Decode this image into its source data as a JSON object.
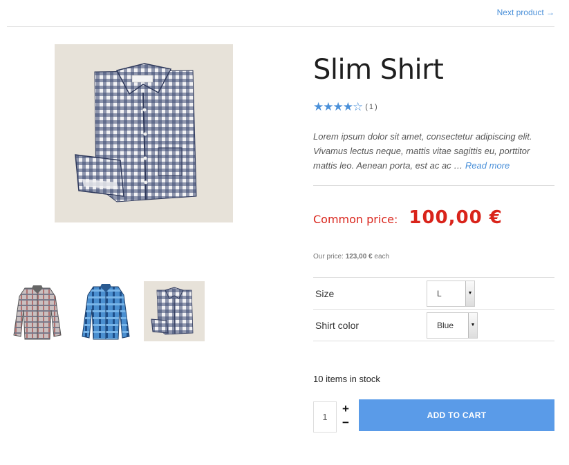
{
  "nav": {
    "next_label": "Next product →"
  },
  "product": {
    "title": "Slim Shirt",
    "rating": {
      "stars": 4.5,
      "stars_display": "★★★★☆",
      "count": "(1)"
    },
    "description": "Lorem ipsum dolor sit amet, consectetur adipiscing elit. Vivamus lectus neque, mattis vitae sagittis eu, porttitor mattis leo. Aenean porta, est ac ac …",
    "read_more": "Read more",
    "common_price_label": "Common price:",
    "common_price_value": "100,00 €",
    "our_price_label": "Our price:",
    "our_price_value": "123,00 €",
    "our_price_unit": "each"
  },
  "images": {
    "main": "checked-shirt-folded",
    "thumbs": [
      {
        "name": "grey-plaid-shirt-thumb"
      },
      {
        "name": "blue-plaid-shirt-thumb"
      },
      {
        "name": "navy-gingham-folded-thumb"
      }
    ]
  },
  "options": {
    "size": {
      "label": "Size",
      "value": "L"
    },
    "color": {
      "label": "Shirt color",
      "value": "Blue"
    }
  },
  "stock": {
    "text": "10 items in stock"
  },
  "cart": {
    "quantity": "1",
    "plus": "+",
    "minus": "−",
    "add_label": "ADD TO CART"
  },
  "colors": {
    "accent": "#4a90d9",
    "button": "#5a9be8",
    "price": "#d9241b"
  }
}
